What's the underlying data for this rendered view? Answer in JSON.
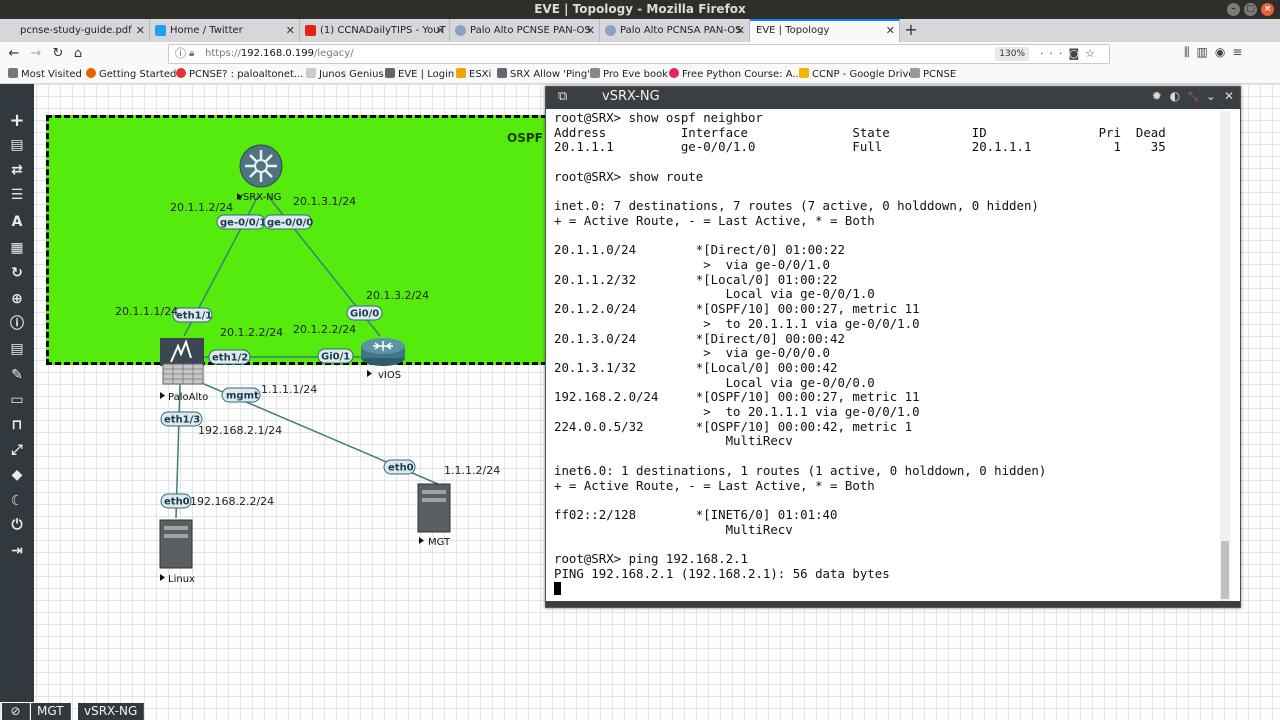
{
  "window": {
    "title": "EVE | Topology - Mozilla Firefox"
  },
  "tabs": [
    {
      "label": "pcnse-study-guide.pdf",
      "favicon": "pdf-icon"
    },
    {
      "label": "Home / Twitter",
      "favicon": "twitter-icon"
    },
    {
      "label": "(1) CCNADailyTIPS - YouT",
      "favicon": "youtube-icon"
    },
    {
      "label": "Palo Alto PCNSE PAN-OS",
      "favicon": "globe-icon"
    },
    {
      "label": "Palo Alto PCNSA PAN-OS",
      "favicon": "globe-icon"
    },
    {
      "label": "EVE | Topology",
      "favicon": "none",
      "active": true
    }
  ],
  "nav": {
    "url_scheme": "https://",
    "url_host": "192.168.0.199",
    "url_path": "/legacy/",
    "zoom": "130%"
  },
  "bookmarks": [
    "Most Visited",
    "Getting Started",
    "PCNSE? : paloaltonet...",
    "Junos Genius",
    "EVE | Login",
    "ESXi",
    "SRX Allow 'Ping'",
    "Pro Eve book",
    "Free Python Course: A...",
    "CCNP - Google Drive",
    "PCNSE"
  ],
  "colors": {
    "ospf_area": "#55ec0d",
    "sidebar": "#31393e",
    "link": "#3e7e7a",
    "active_tab_accent": "#0a84ff"
  },
  "topology": {
    "area_label": "OSPF A",
    "nodes": {
      "vsrx": "vSRX-NG",
      "paloalto": "PaloAlto",
      "vios": "vIOS",
      "linux": "Linux",
      "mgt": "MGT"
    },
    "interfaces": {
      "vsrx_ge001": "ge-0/0/1",
      "vsrx_ge000": "ge-0/0/0",
      "pa_eth11": "eth1/1",
      "pa_eth12": "eth1/2",
      "pa_mgmt": "mgmt",
      "pa_eth13": "eth1/3",
      "vios_gi00": "Gi0/0",
      "vios_gi01": "Gi0/1",
      "linux_eth0": "eth0",
      "mgt_eth0": "eth0"
    },
    "ips": {
      "vsrx_ge001": "20.1.1.2/24",
      "vsrx_ge000": "20.1.3.1/24",
      "pa_eth11": "20.1.1.1/24",
      "pa_eth12": "20.1.2.2/24",
      "vios_gi01": "20.1.2.2/24",
      "vios_gi00": "20.1.3.2/24",
      "pa_mgmt": "1.1.1.1/24",
      "mgt_eth0": "1.1.1.2/24",
      "pa_eth13": "192.168.2.1/24",
      "linux_eth0": "192.168.2.2/24"
    }
  },
  "terminal": {
    "title": "vSRX-NG",
    "lines": [
      "root@SRX> show ospf neighbor",
      "Address          Interface              State           ID               Pri  Dead",
      "20.1.1.1         ge-0/0/1.0             Full            20.1.1.1           1    35",
      "",
      "root@SRX> show route",
      "",
      "inet.0: 7 destinations, 7 routes (7 active, 0 holddown, 0 hidden)",
      "+ = Active Route, - = Last Active, * = Both",
      "",
      "20.1.1.0/24        *[Direct/0] 01:00:22",
      "                    >  via ge-0/0/1.0",
      "20.1.1.2/32        *[Local/0] 01:00:22",
      "                       Local via ge-0/0/1.0",
      "20.1.2.0/24        *[OSPF/10] 00:00:27, metric 11",
      "                    >  to 20.1.1.1 via ge-0/0/1.0",
      "20.1.3.0/24        *[Direct/0] 00:00:42",
      "                    >  via ge-0/0/0.0",
      "20.1.3.1/32        *[Local/0] 00:00:42",
      "                       Local via ge-0/0/0.0",
      "192.168.2.0/24     *[OSPF/10] 00:00:27, metric 11",
      "                    >  to 20.1.1.1 via ge-0/0/1.0",
      "224.0.0.5/32       *[OSPF/10] 00:00:42, metric 1",
      "                       MultiRecv",
      "",
      "inet6.0: 1 destinations, 1 routes (1 active, 0 holddown, 0 hidden)",
      "+ = Active Route, - = Last Active, * = Both",
      "",
      "ff02::2/128        *[INET6/0] 01:01:40",
      "                       MultiRecv",
      "",
      "root@SRX> ping 192.168.2.1",
      "PING 192.168.2.1 (192.168.2.1): 56 data bytes"
    ]
  },
  "taskbar": {
    "items": [
      "MGT",
      "vSRX-NG"
    ]
  }
}
